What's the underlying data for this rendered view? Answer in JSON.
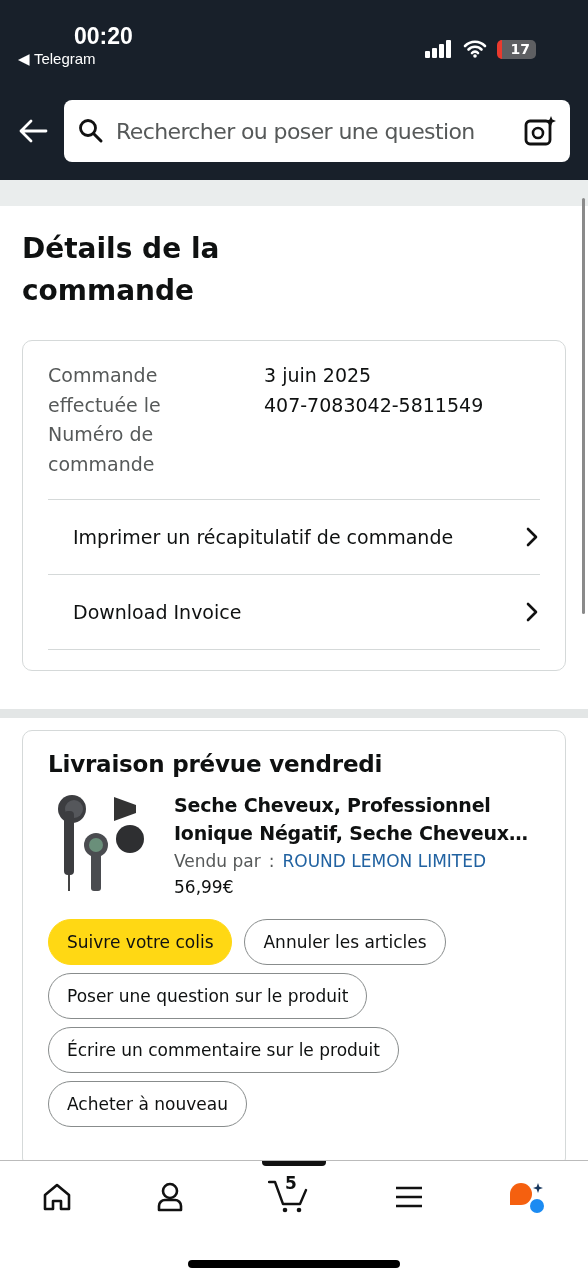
{
  "status_bar": {
    "time": "00:20",
    "back_app": "◀ Telegram",
    "battery": "17"
  },
  "search": {
    "placeholder": "Rechercher ou poser une question"
  },
  "order": {
    "title": "Détails de la commande",
    "labels": [
      "Commande effectuée le",
      "Numéro de commande"
    ],
    "values": [
      "3 juin 2025",
      "407-7083042-5811549"
    ],
    "links": [
      "Imprimer un récapitulatif de commande",
      "Download Invoice"
    ]
  },
  "delivery": {
    "title": "Livraison prévue vendredi",
    "product": {
      "kind": "picture",
      "name": "Seche Cheveux, Professionnel Ionique Négatif, Seche Cheveux…",
      "sold_by_label": "Vendu par",
      "sold_by_sep": ":",
      "seller": "ROUND LEMON LIMITED",
      "price": "56,99€"
    },
    "actions": [
      {
        "label": "Suivre votre colis",
        "primary": true
      },
      {
        "label": "Annuler les articles",
        "primary": false
      },
      {
        "label": "Poser une question sur le produit",
        "primary": false
      },
      {
        "label": "Écrire un commentaire sur le produit",
        "primary": false
      },
      {
        "label": "Acheter à nouveau",
        "primary": false
      }
    ]
  },
  "tab_bar": {
    "cart_count": "5"
  }
}
